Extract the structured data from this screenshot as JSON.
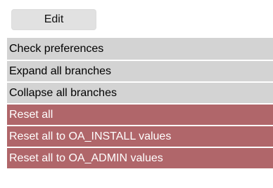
{
  "toolbar": {
    "edit_label": "Edit"
  },
  "menu": {
    "items": [
      {
        "label": "Check preferences"
      },
      {
        "label": "Expand all branches"
      },
      {
        "label": "Collapse all branches"
      },
      {
        "label": "Reset all"
      },
      {
        "label": "Reset all to OA_INSTALL values"
      },
      {
        "label": "Reset all to OA_ADMIN values"
      }
    ]
  },
  "colors": {
    "normal_bg": "#d3d3d3",
    "danger_bg": "#b0666a",
    "button_bg": "#e1e1e1"
  }
}
